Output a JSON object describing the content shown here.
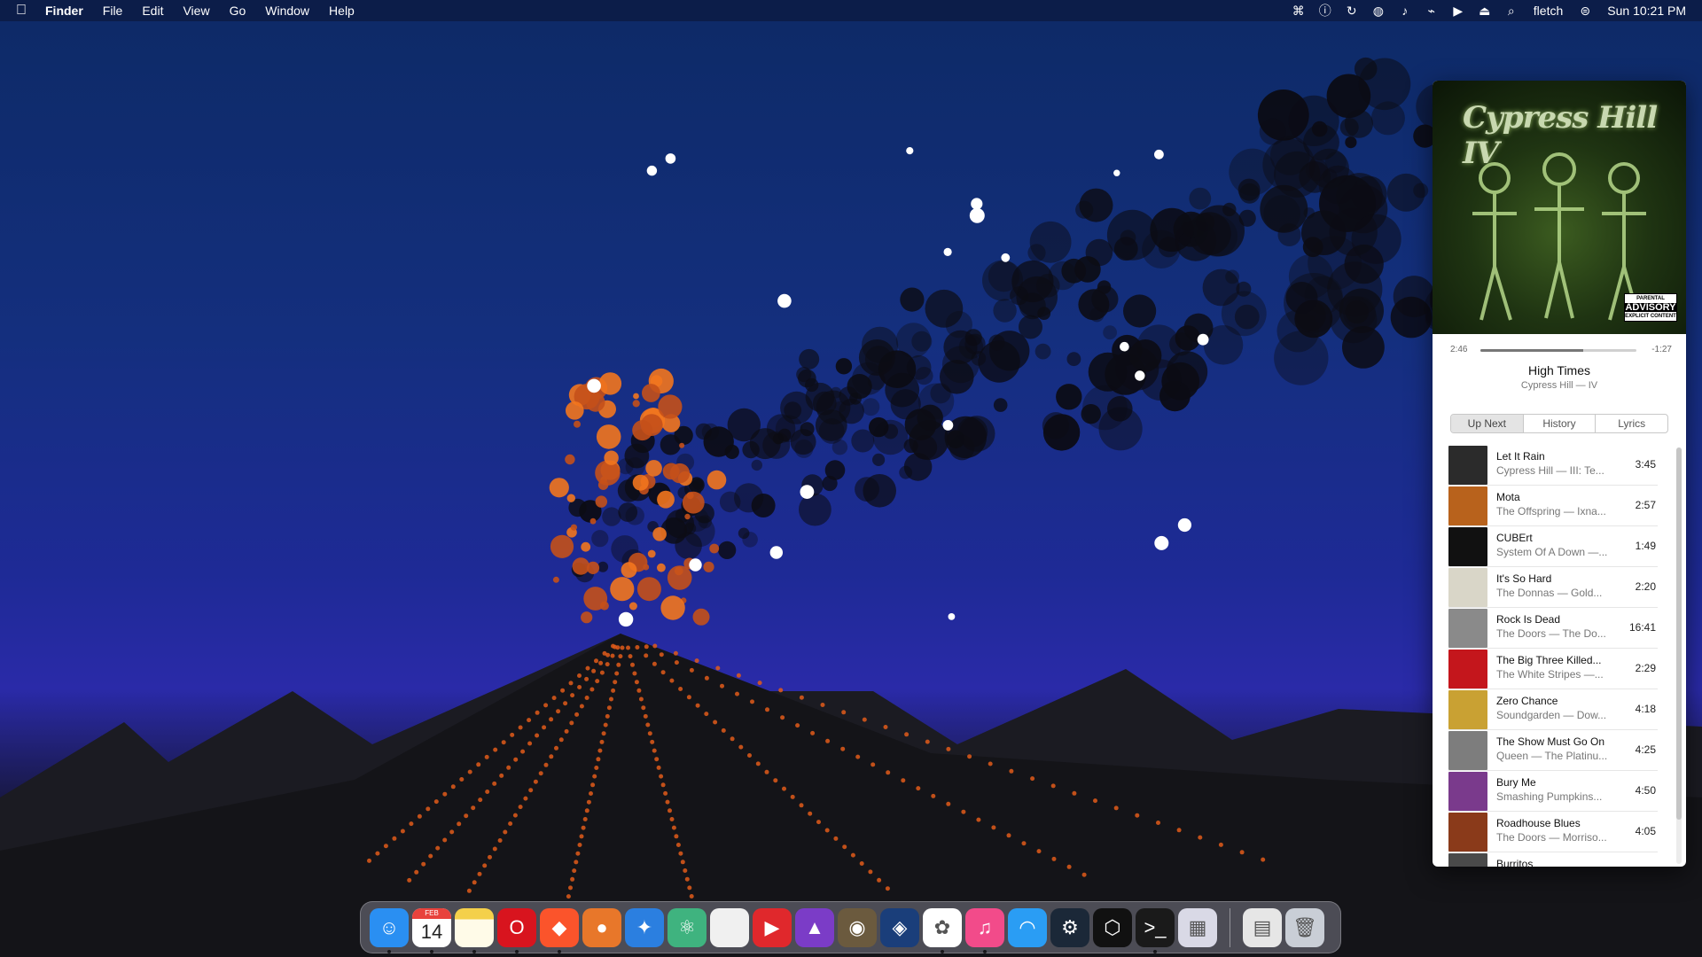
{
  "menubar": {
    "apple_icon": "apple-icon",
    "app_name": "Finder",
    "menus": [
      "File",
      "Edit",
      "View",
      "Go",
      "Window",
      "Help"
    ],
    "status_icons": [
      "control-center-icon",
      "accessibility-icon",
      "sync-icon",
      "globe-icon",
      "volume-icon",
      "wifi-off-icon",
      "play-icon",
      "eject-icon",
      "search-icon"
    ],
    "user": "fletch",
    "toggle_icon": "toggle-icon",
    "clock": "Sun 10:21 PM"
  },
  "player": {
    "album_art_text": "Cypress Hill IV",
    "advisory_top": "PARENTAL",
    "advisory_mid": "ADVISORY",
    "advisory_bottom": "EXPLICIT CONTENT",
    "elapsed": "2:46",
    "remaining": "-1:27",
    "progress_fraction": 0.66,
    "title": "High Times",
    "subtitle": "Cypress Hill — IV",
    "tabs": [
      "Up Next",
      "History",
      "Lyrics"
    ],
    "active_tab": "Up Next",
    "queue": [
      {
        "title": "Let It Rain",
        "sub": "Cypress Hill — III: Te...",
        "duration": "3:45",
        "color": "#2b2b2b"
      },
      {
        "title": "Mota",
        "sub": "The Offspring — Ixna...",
        "duration": "2:57",
        "color": "#b8621c"
      },
      {
        "title": "CUBErt",
        "sub": "System Of A Down —...",
        "duration": "1:49",
        "color": "#111111"
      },
      {
        "title": "It's So Hard",
        "sub": "The Donnas — Gold...",
        "duration": "2:20",
        "color": "#d9d6c8"
      },
      {
        "title": "Rock Is Dead",
        "sub": "The Doors — The Do...",
        "duration": "16:41",
        "color": "#8a8a8a"
      },
      {
        "title": "The Big Three Killed...",
        "sub": "The White Stripes —...",
        "duration": "2:29",
        "color": "#c4161c"
      },
      {
        "title": "Zero Chance",
        "sub": "Soundgarden — Dow...",
        "duration": "4:18",
        "color": "#c9a133"
      },
      {
        "title": "The Show Must Go On",
        "sub": "Queen — The Platinu...",
        "duration": "4:25",
        "color": "#7d7d7d"
      },
      {
        "title": "Bury Me",
        "sub": "Smashing Pumpkins...",
        "duration": "4:50",
        "color": "#7a3a8c"
      },
      {
        "title": "Roadhouse Blues",
        "sub": "The Doors — Morriso...",
        "duration": "4:05",
        "color": "#8a3a1a"
      },
      {
        "title": "Burritos",
        "sub": "",
        "duration": "",
        "color": "#4a4a4a"
      }
    ]
  },
  "dock": {
    "calendar_month": "FEB",
    "calendar_day": "14",
    "apps": [
      {
        "name": "finder-icon",
        "glyph": "☺",
        "bg": "#2a8ff2",
        "dot": true
      },
      {
        "name": "calendar-icon",
        "glyph": "",
        "bg": "#ffffff",
        "dot": true
      },
      {
        "name": "notes-icon",
        "glyph": "",
        "bg": "#f4d04a",
        "dot": true
      },
      {
        "name": "opera-icon",
        "glyph": "O",
        "bg": "#d8141e",
        "dot": true
      },
      {
        "name": "brave-icon",
        "glyph": "◆",
        "bg": "#fb542b",
        "dot": true
      },
      {
        "name": "firefox-icon",
        "glyph": "●",
        "bg": "#e8772a",
        "dot": false
      },
      {
        "name": "safari-icon",
        "glyph": "✦",
        "bg": "#2b7fe0",
        "dot": false
      },
      {
        "name": "atom-icon",
        "glyph": "⚛",
        "bg": "#3fb37f",
        "dot": false
      },
      {
        "name": "text-file-icon",
        "glyph": "",
        "bg": "#f0f0f0",
        "dot": false
      },
      {
        "name": "pdf-app-icon",
        "glyph": "▶",
        "bg": "#e0282c",
        "dot": false
      },
      {
        "name": "affinity-photo-icon",
        "glyph": "▲",
        "bg": "#7b3cc7",
        "dot": false
      },
      {
        "name": "gimp-icon",
        "glyph": "◉",
        "bg": "#6b5a3e",
        "dot": false
      },
      {
        "name": "layers-app-icon",
        "glyph": "◈",
        "bg": "#1a3e7a",
        "dot": false
      },
      {
        "name": "photos-icon",
        "glyph": "✿",
        "bg": "#ffffff",
        "dot": true
      },
      {
        "name": "itunes-icon",
        "glyph": "♫",
        "bg": "#f24b8a",
        "dot": true
      },
      {
        "name": "wifi-app-icon",
        "glyph": "◠",
        "bg": "#2a9df4",
        "dot": false
      },
      {
        "name": "steam-icon",
        "glyph": "⚙",
        "bg": "#1b2838",
        "dot": false
      },
      {
        "name": "gog-icon",
        "glyph": "⬡",
        "bg": "#111111",
        "dot": false
      },
      {
        "name": "terminal-icon",
        "glyph": ">_",
        "bg": "#1a1a1a",
        "dot": true
      },
      {
        "name": "launchpad-icon",
        "glyph": "▦",
        "bg": "#d9d9e6",
        "dot": false
      }
    ],
    "after_separator": [
      {
        "name": "document-stack-icon",
        "glyph": "▤",
        "bg": "#e6e6e6",
        "dot": false
      },
      {
        "name": "trash-icon",
        "glyph": "🗑",
        "bg": "#c9ced6",
        "dot": false
      }
    ]
  }
}
